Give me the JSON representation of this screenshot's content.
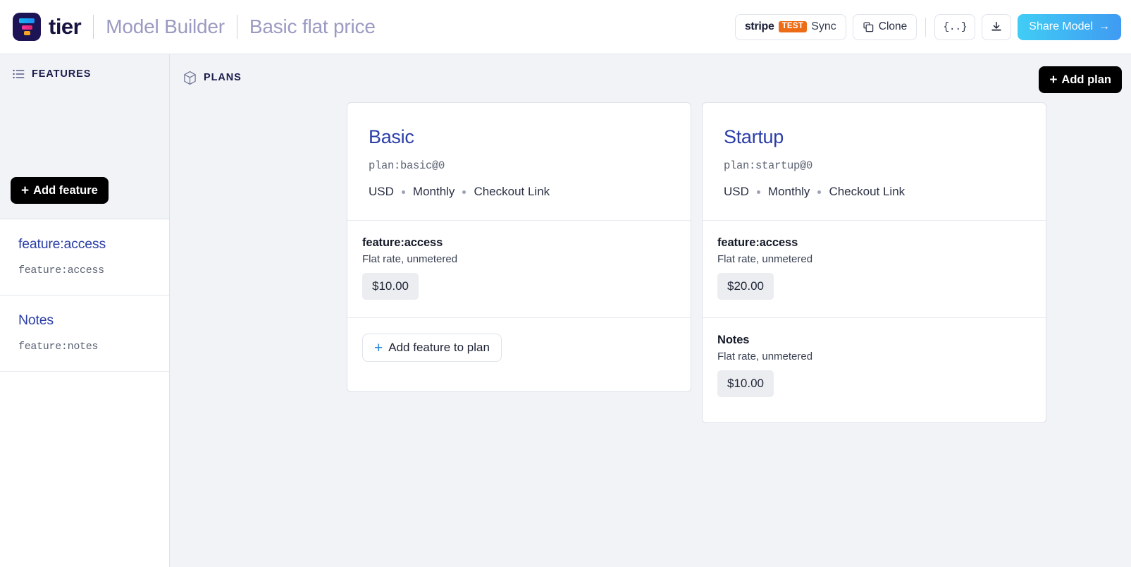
{
  "header": {
    "brand_name": "tier",
    "brand_logo_icon": "tier-funnel-logo",
    "breadcrumb": [
      "Model Builder",
      "Basic flat price"
    ],
    "actions": {
      "stripe_sync": {
        "brand": "stripe",
        "badge": "TEST",
        "label": "Sync",
        "badge_color": "#ed6c16"
      },
      "clone": {
        "label": "Clone",
        "icon": "copy-icon"
      },
      "json": {
        "label": "{..}",
        "icon": "code-braces-icon"
      },
      "download": {
        "label": "",
        "icon": "download-icon"
      },
      "share": {
        "label": "Share Model",
        "arrow": "→",
        "accent_from": "#41cdf5",
        "accent_to": "#3f9bf2"
      }
    }
  },
  "sidebar": {
    "header": {
      "icon": "list-icon",
      "label": "FEATURES"
    },
    "add_feature_button": {
      "plus": "+",
      "label": "Add feature"
    },
    "features": [
      {
        "title": "feature:access",
        "id": "feature:access"
      },
      {
        "title": "Notes",
        "id": "feature:notes"
      }
    ]
  },
  "main": {
    "header": {
      "icon": "cube-icon",
      "label": "PLANS"
    },
    "add_plan_button": {
      "plus": "+",
      "label": "Add plan"
    },
    "plans": [
      {
        "name": "Basic",
        "id": "plan:basic@0",
        "meta": [
          "USD",
          "Monthly",
          "Checkout Link"
        ],
        "features": [
          {
            "title": "feature:access",
            "subtitle": "Flat rate, unmetered",
            "price": "$10.00"
          }
        ],
        "add_feature_button": {
          "plus": "+",
          "label": "Add feature to plan"
        },
        "has_add_feature_button": true
      },
      {
        "name": "Startup",
        "id": "plan:startup@0",
        "meta": [
          "USD",
          "Monthly",
          "Checkout Link"
        ],
        "features": [
          {
            "title": "feature:access",
            "subtitle": "Flat rate, unmetered",
            "price": "$20.00"
          },
          {
            "title": "Notes",
            "subtitle": "Flat rate, unmetered",
            "price": "$10.00"
          }
        ],
        "has_add_feature_button": false
      }
    ]
  }
}
